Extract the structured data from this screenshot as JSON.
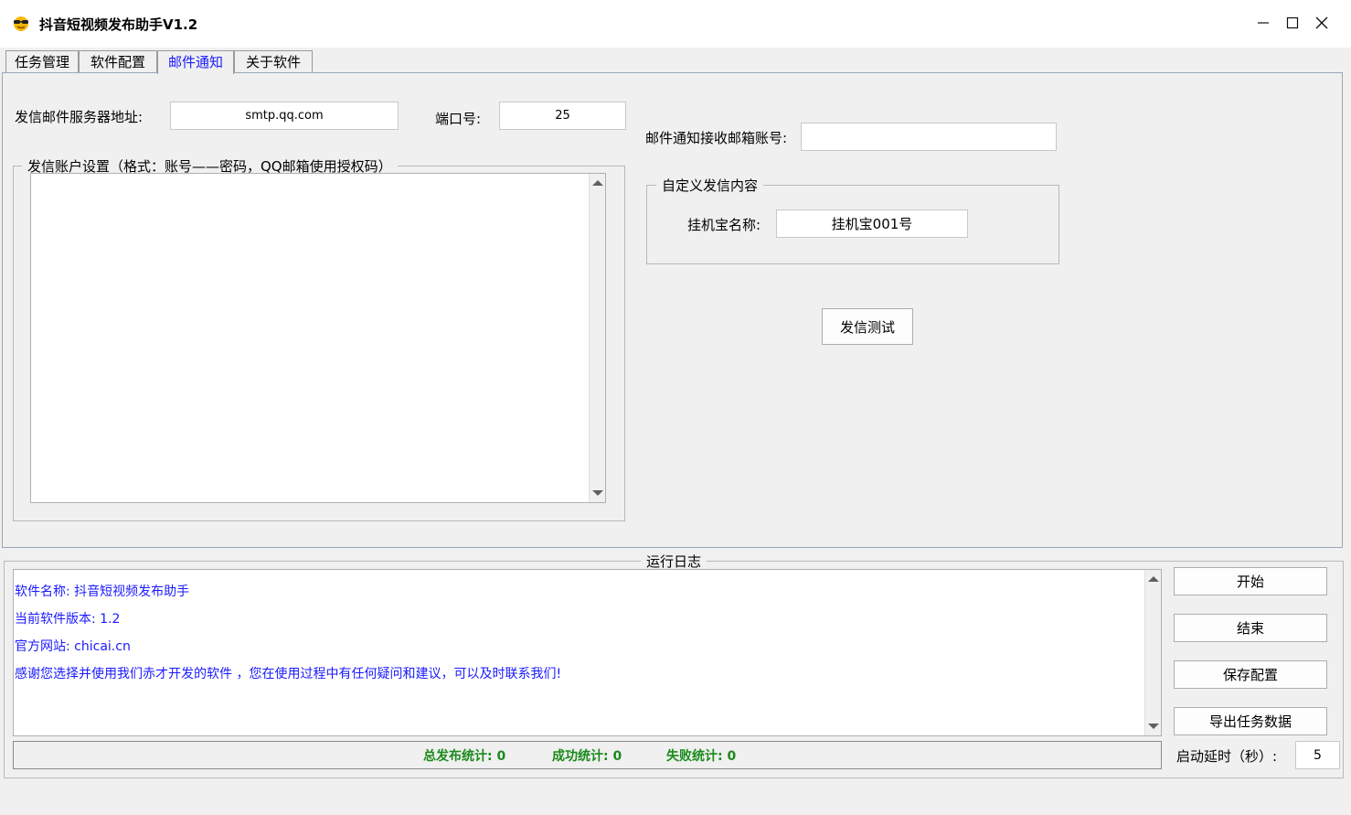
{
  "window": {
    "title": "抖音短视频发布助手V1.2",
    "controls": {
      "minimize": "—",
      "maximize": "☐",
      "close": "✕"
    }
  },
  "tabs": [
    {
      "label": "任务管理",
      "active": false
    },
    {
      "label": "软件配置",
      "active": false
    },
    {
      "label": "邮件通知",
      "active": true
    },
    {
      "label": "关于软件",
      "active": false
    }
  ],
  "mail": {
    "smtp_label": "发信邮件服务器地址:",
    "smtp_value": "smtp.qq.com",
    "port_label": "端口号:",
    "port_value": "25",
    "receiver_label": "邮件通知接收邮箱账号:",
    "receiver_value": "",
    "account_group_title": "发信账户设置（格式：账号——密码，QQ邮箱使用授权码）",
    "account_value": "",
    "custom_group_title": "自定义发信内容",
    "machine_name_label": "挂机宝名称:",
    "machine_name_value": "挂机宝001号",
    "test_button": "发信测试"
  },
  "log": {
    "title": "运行日志",
    "lines": [
      "软件名称: 抖音短视频发布助手",
      "当前软件版本: 1.2",
      "官方网站: chicai.cn",
      "感谢您选择并使用我们赤才开发的软件 ，您在使用过程中有任何疑问和建议，可以及时联系我们!"
    ]
  },
  "stats": {
    "total": "总发布统计: 0",
    "success": "成功统计: 0",
    "fail": "失败统计: 0"
  },
  "actions": {
    "start": "开始",
    "stop": "结束",
    "save": "保存配置",
    "export": "导出任务数据",
    "delay_label": "启动延时（秒）:",
    "delay_value": "5"
  },
  "colors": {
    "link_blue": "#1a1aff",
    "stats_green": "#1a8a1a"
  }
}
